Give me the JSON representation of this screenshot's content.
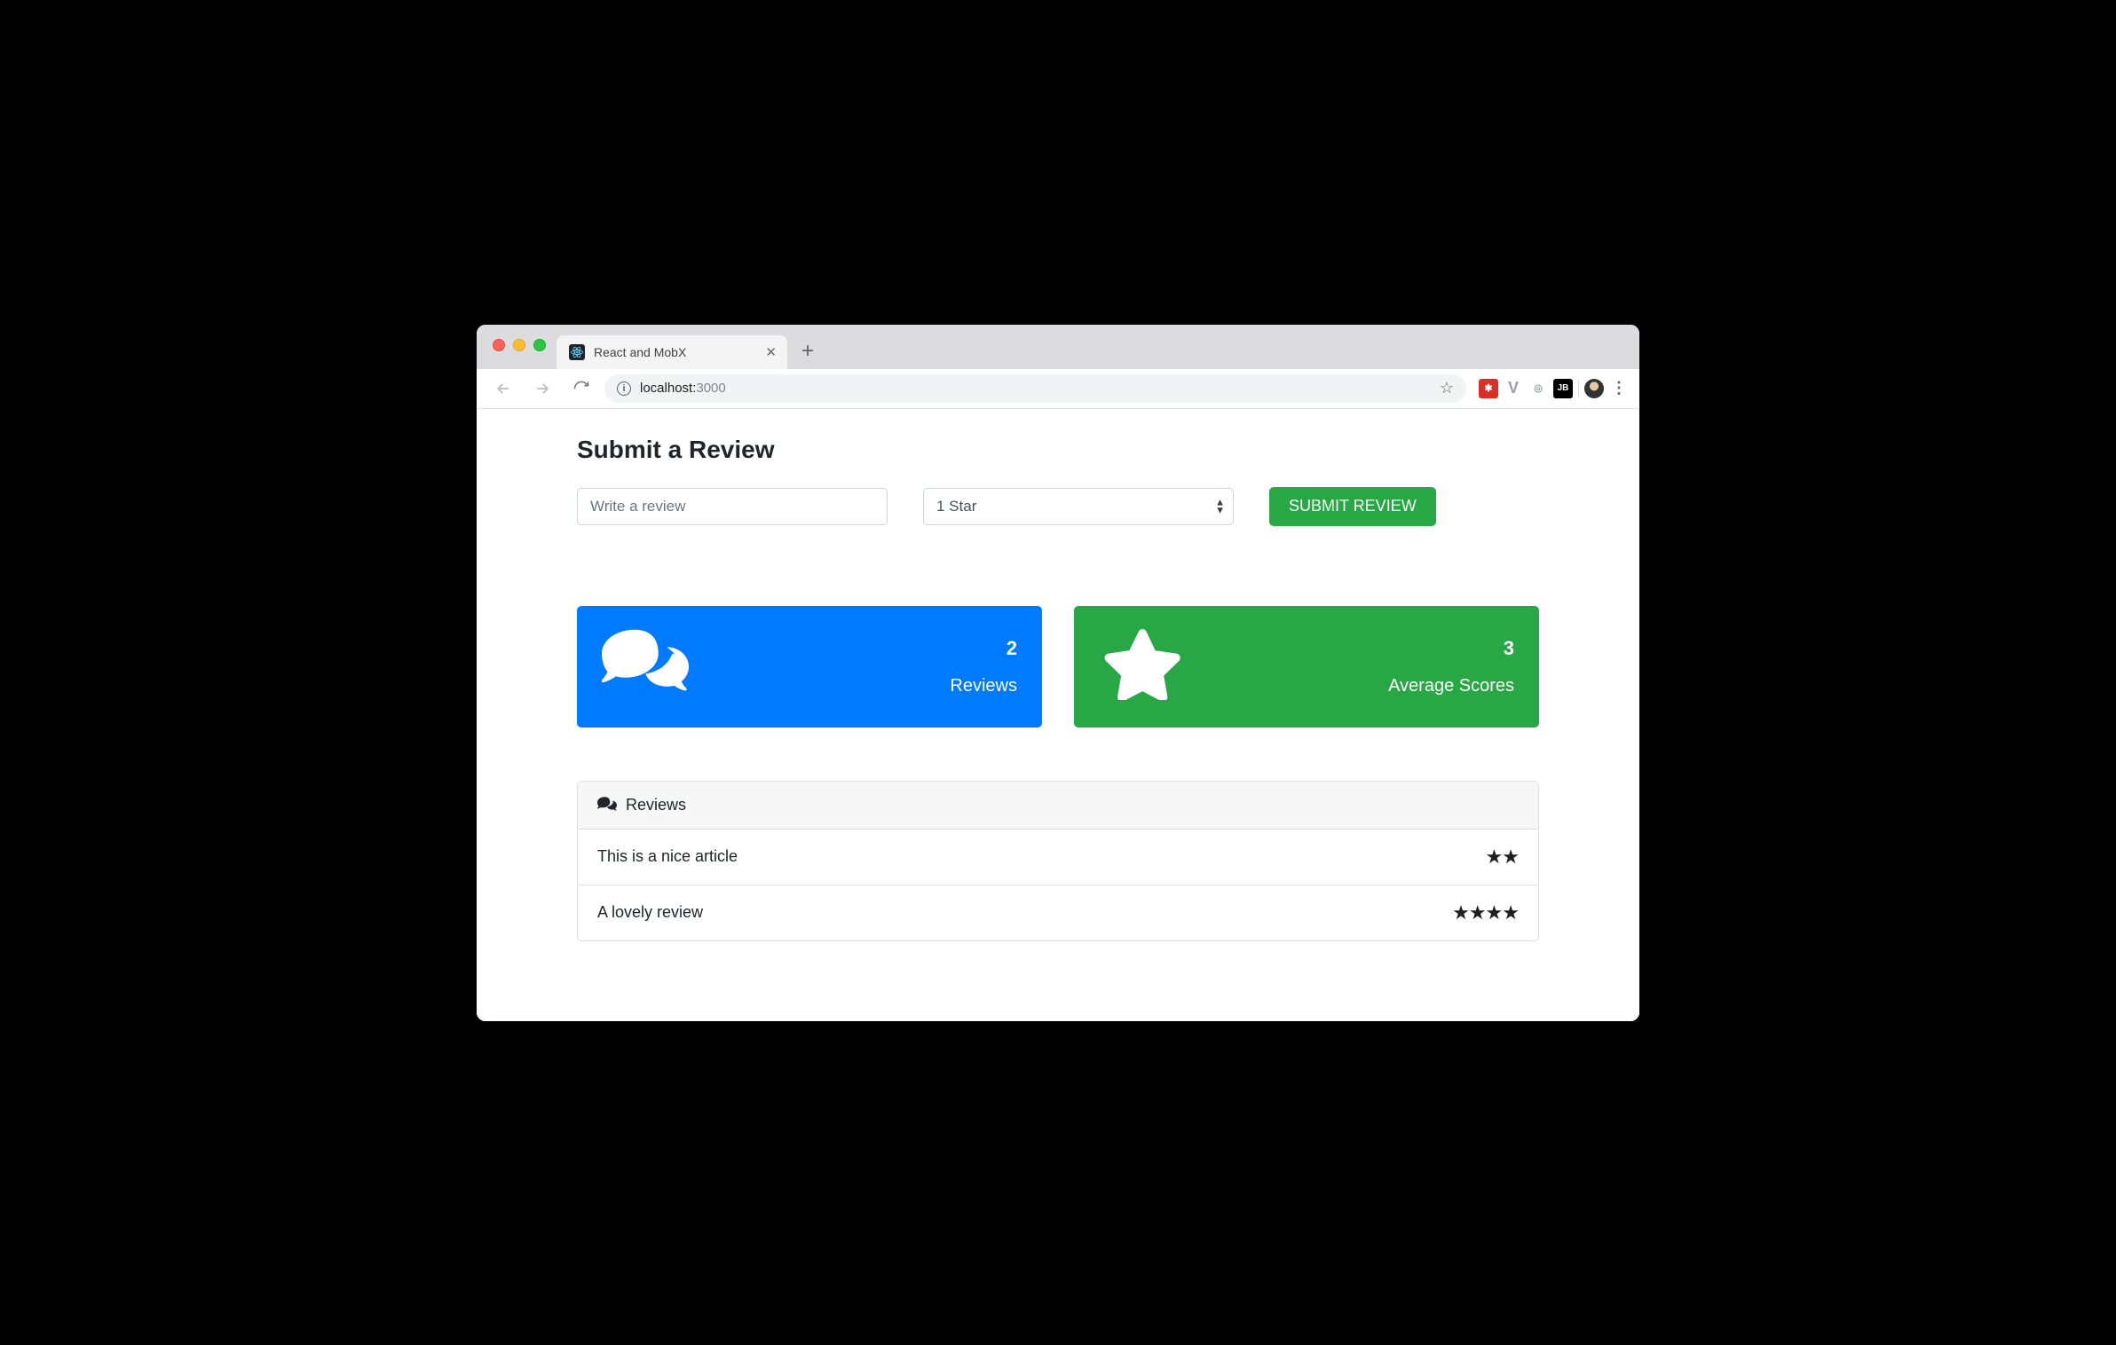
{
  "browser": {
    "tab_title": "React and MobX",
    "url_host": "localhost:",
    "url_port": "3000"
  },
  "page": {
    "heading": "Submit a Review",
    "input_placeholder": "Write a review",
    "select_value": "1 Star",
    "submit_label": "SUBMIT REVIEW"
  },
  "stats": {
    "reviews": {
      "count": "2",
      "label": "Reviews"
    },
    "avg": {
      "count": "3",
      "label": "Average Scores"
    }
  },
  "panel": {
    "title": "Reviews",
    "items": [
      {
        "text": "This is a nice article",
        "stars": "★★"
      },
      {
        "text": "A lovely review",
        "stars": "★★★★"
      }
    ]
  }
}
